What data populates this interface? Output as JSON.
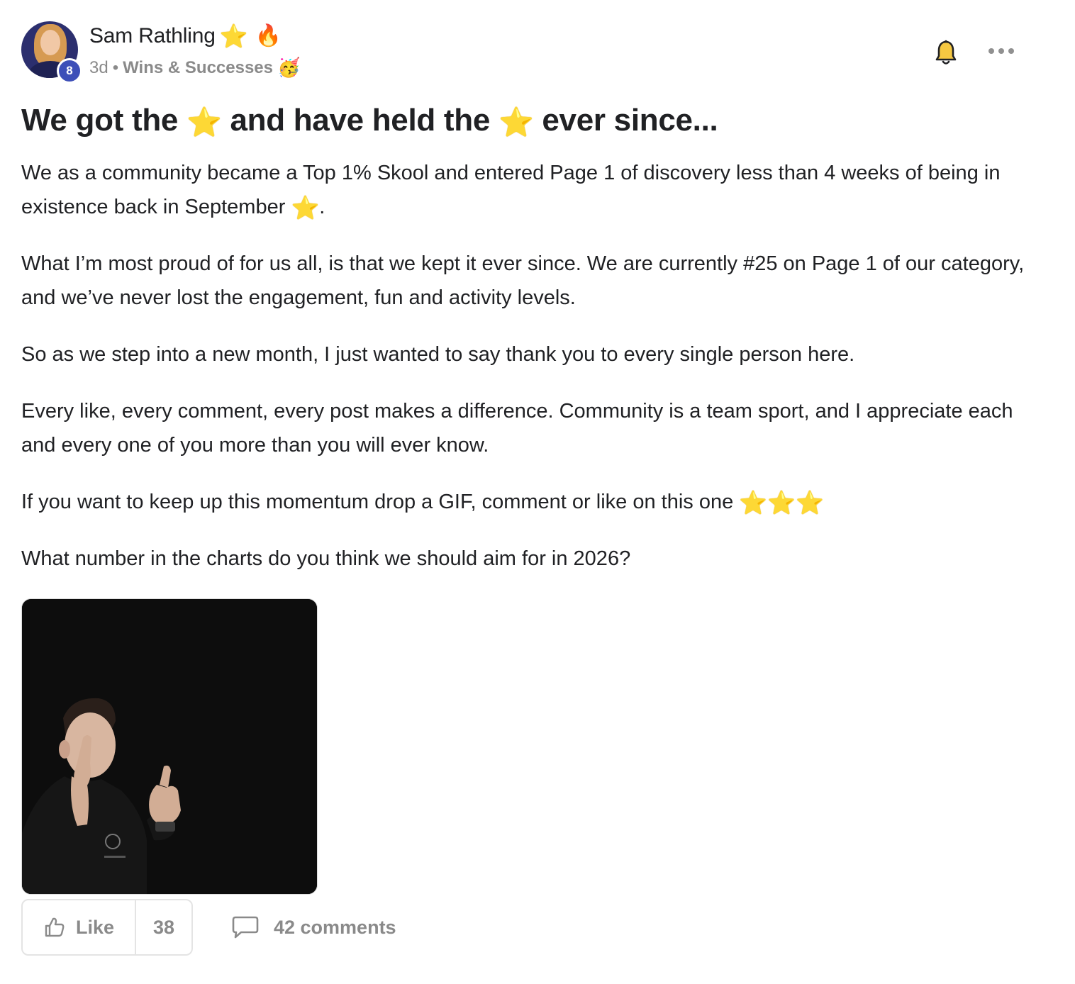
{
  "post": {
    "author": {
      "name": "Sam Rathling",
      "badges": [
        "⭐",
        "🔥"
      ],
      "level": "8",
      "avatar_icon": "user-avatar"
    },
    "meta": {
      "time_ago": "3d",
      "separator": "•",
      "category": "Wins & Successes",
      "category_emoji": "🥳"
    },
    "title": {
      "part1": "We got the",
      "part2": "and have held the",
      "part3": "ever since...",
      "emoji": "⭐"
    },
    "body": {
      "p1_text": "We as a community became a Top 1% Skool and entered Page 1 of discovery less than 4 weeks of being in existence back in September",
      "p1_emoji": "⭐",
      "p1_end": ".",
      "p2": "What I’m most proud of for us all, is that we kept it ever since. We are currently #25 on Page 1 of our category, and we’ve never lost the engagement, fun and activity levels.",
      "p3": "So as we step into a new month, I just wanted to say thank you to every single person here.",
      "p4": "Every like, every comment, every post makes a difference. Community is a team sport, and I appreciate each and every one of you more than you will ever know.",
      "p5_text": "If you want to keep up this momentum drop a GIF, comment or like on this one",
      "p5_emoji": "⭐⭐⭐",
      "p6": "What number in the charts do you think we should aim for in 2026?"
    },
    "actions": {
      "like_label": "Like",
      "like_count": "38",
      "comments_label": "42 comments"
    },
    "icons": {
      "bell": "bell-icon",
      "more": "more-options-icon",
      "like": "thumbs-up-icon",
      "comment": "comment-bubble-icon"
    },
    "colors": {
      "level_badge": "#3d4fb8",
      "muted_text": "#8a8a8a",
      "bell_fill": "#f5c842"
    }
  }
}
